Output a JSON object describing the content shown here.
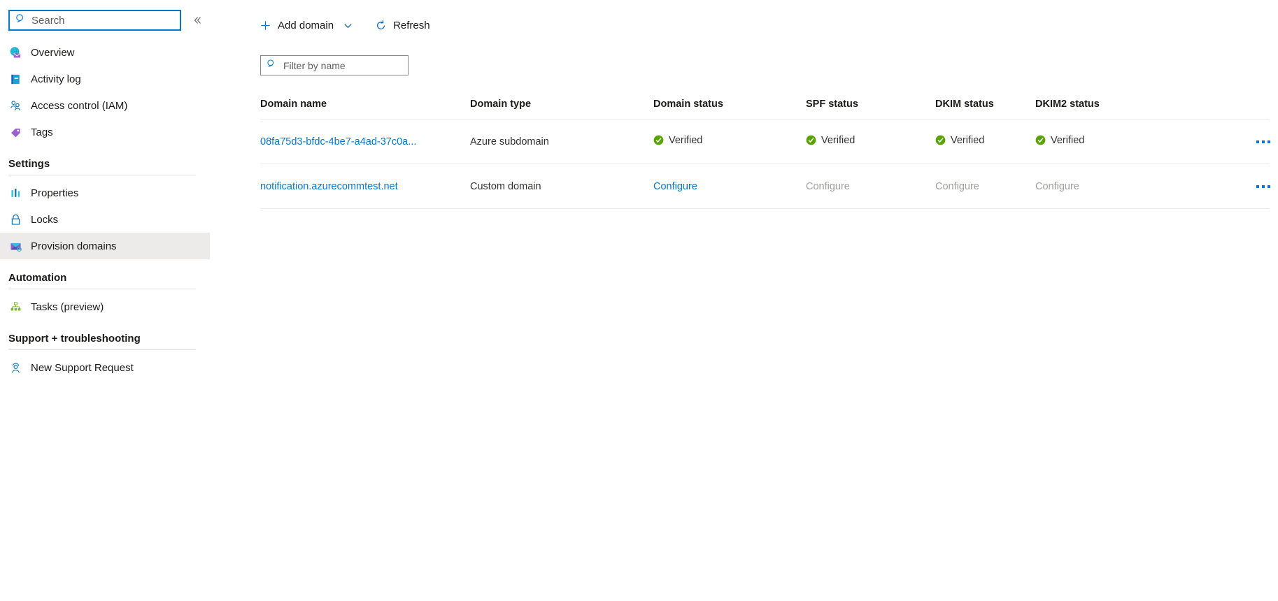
{
  "sidebar": {
    "search": {
      "placeholder": "Search",
      "value": "",
      "icon": "search-icon"
    },
    "collapse": {
      "icon": "chevron-double-left-icon",
      "label": "«"
    },
    "items": [
      {
        "label": "Overview",
        "icon": "overview-globe-mail-icon",
        "selected": false
      },
      {
        "label": "Activity log",
        "icon": "activity-log-book-icon",
        "selected": false
      },
      {
        "label": "Access control (IAM)",
        "icon": "access-control-people-icon",
        "selected": false
      },
      {
        "label": "Tags",
        "icon": "tag-icon",
        "selected": false
      }
    ],
    "groups": [
      {
        "title": "Settings",
        "items": [
          {
            "label": "Properties",
            "icon": "properties-bars-icon",
            "selected": false
          },
          {
            "label": "Locks",
            "icon": "lock-icon",
            "selected": false
          },
          {
            "label": "Provision domains",
            "icon": "provision-domains-mail-icon",
            "selected": true
          }
        ]
      },
      {
        "title": "Automation",
        "items": [
          {
            "label": "Tasks (preview)",
            "icon": "tasks-hierarchy-icon",
            "selected": false
          }
        ]
      },
      {
        "title": "Support + troubleshooting",
        "items": [
          {
            "label": "New Support Request",
            "icon": "support-person-icon",
            "selected": false
          }
        ]
      }
    ]
  },
  "toolbar": {
    "add_domain_label": "Add domain",
    "add_domain_icon": "plus-icon",
    "add_domain_chevron": "chevron-down-icon",
    "refresh_label": "Refresh",
    "refresh_icon": "refresh-icon"
  },
  "filter": {
    "placeholder": "Filter by name",
    "value": "",
    "icon": "search-icon"
  },
  "table": {
    "columns": [
      "Domain name",
      "Domain type",
      "Domain status",
      "SPF status",
      "DKIM status",
      "DKIM2 status"
    ],
    "rows": [
      {
        "name": "08fa75d3-bfdc-4be7-a4ad-37c0a...",
        "type": "Azure subdomain",
        "domain_status": "Verified",
        "domain_status_state": "verified",
        "spf_status": "Verified",
        "spf_status_state": "verified",
        "dkim_status": "Verified",
        "dkim_status_state": "verified",
        "dkim2_status": "Verified",
        "dkim2_status_state": "verified",
        "more": "..."
      },
      {
        "name": "notification.azurecommtest.net",
        "type": "Custom domain",
        "domain_status": "Configure",
        "domain_status_state": "link",
        "spf_status": "Configure",
        "spf_status_state": "disabled",
        "dkim_status": "Configure",
        "dkim_status_state": "disabled",
        "dkim2_status": "Configure",
        "dkim2_status_state": "disabled",
        "more": "..."
      }
    ]
  },
  "colors": {
    "accent": "#0078d4",
    "verified_green": "#57a300",
    "disabled_text": "#a19f9d",
    "selected_bg": "#edebe9",
    "divider": "#edebe9"
  }
}
